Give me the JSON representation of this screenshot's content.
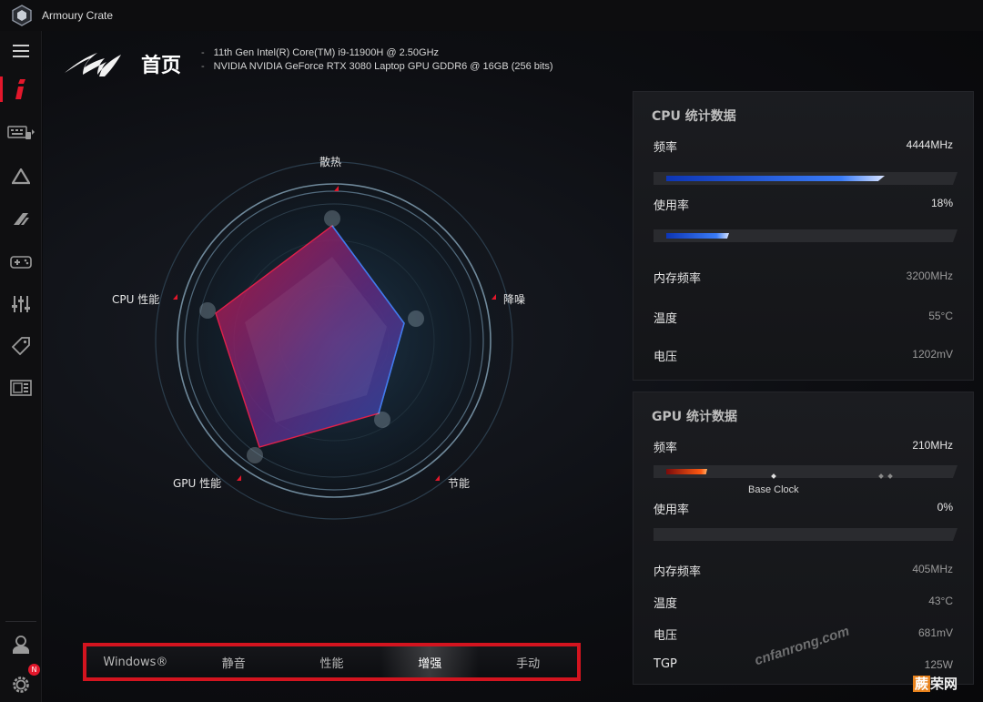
{
  "window": {
    "title": "Armoury Crate"
  },
  "header": {
    "title": "首页",
    "specs": [
      "11th Gen Intel(R) Core(TM) i9-11900H @ 2.50GHz",
      "NVIDIA NVIDIA GeForce RTX 3080 Laptop GPU GDDR6 @ 16GB (256 bits)"
    ]
  },
  "sidebar": {
    "items": [
      {
        "icon": "menu-icon"
      },
      {
        "icon": "home-info-icon",
        "active": true
      },
      {
        "icon": "keyboard-lighting-icon"
      },
      {
        "icon": "aura-sync-icon"
      },
      {
        "icon": "game-visual-icon"
      },
      {
        "icon": "gamepad-icon"
      },
      {
        "icon": "equalizer-icon"
      },
      {
        "icon": "deals-tag-icon"
      },
      {
        "icon": "gallery-icon"
      },
      {
        "icon": "user-profile-icon"
      },
      {
        "icon": "settings-icon"
      }
    ],
    "badge": "N"
  },
  "radar": {
    "labels": {
      "cooling": "散热",
      "noise": "降噪",
      "efficiency": "节能",
      "gpu": "GPU 性能",
      "cpu": "CPU 性能"
    }
  },
  "modes": {
    "items": [
      {
        "label": "Windows®"
      },
      {
        "label": "静音"
      },
      {
        "label": "性能"
      },
      {
        "label": "增强",
        "active": true
      },
      {
        "label": "手动"
      }
    ]
  },
  "cpu_stats": {
    "title": "CPU 统计数据",
    "freq_label": "频率",
    "freq_value": "4444MHz",
    "freq_fill": 0.74,
    "usage_label": "使用率",
    "usage_value": "18%",
    "usage_fill": 0.18,
    "mem_label": "内存频率",
    "mem_value": "3200MHz",
    "temp_label": "温度",
    "temp_value": "55°C",
    "volt_label": "电压",
    "volt_value": "1202mV"
  },
  "gpu_stats": {
    "title": "GPU 统计数据",
    "freq_label": "频率",
    "freq_value": "210MHz",
    "freq_fill": 0.1,
    "base_clock_label": "Base Clock",
    "usage_label": "使用率",
    "usage_value": "0%",
    "mem_label": "内存频率",
    "mem_value": "405MHz",
    "temp_label": "温度",
    "temp_value": "43°C",
    "volt_label": "电压",
    "volt_value": "681mV",
    "tgp_label": "TGP",
    "tgp_value": "125W"
  },
  "watermark": "cnfanrong.com",
  "corner_logo": {
    "part1": "蕨",
    "part2": "荣网"
  },
  "colors": {
    "accent": "#e3172b",
    "bar_blue": "#3a7cf7",
    "bar_red": "#ff5a12"
  }
}
